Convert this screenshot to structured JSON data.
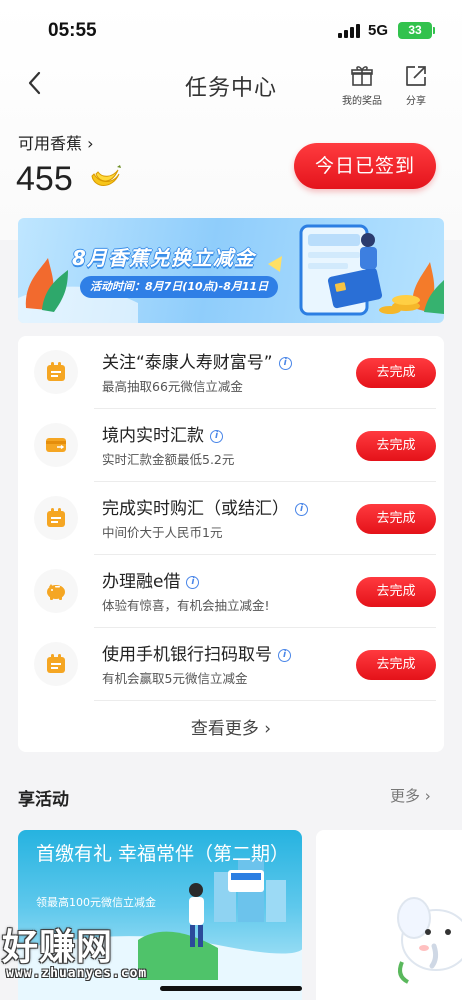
{
  "status_bar": {
    "time": "05:55",
    "network": "5G",
    "battery": "33"
  },
  "nav": {
    "title": "任务中心",
    "actions": [
      {
        "icon": "gift-icon",
        "label": "我的奖品"
      },
      {
        "icon": "share-icon",
        "label": "分享"
      }
    ]
  },
  "points": {
    "label": "可用香蕉 ›",
    "value": "455",
    "icon": "banana-icon"
  },
  "signin_button": "今日已签到",
  "banner": {
    "title": "8月香蕉兑换立减金",
    "time": "活动时间：8月7日(10点)-8月11日"
  },
  "tasks": [
    {
      "title": "关注“泰康人寿财富号”",
      "subtitle": "最高抽取66元微信立减金",
      "button": "去完成",
      "icon": "calendar-icon"
    },
    {
      "title": "境内实时汇款",
      "subtitle": "实时汇款金额最低5.2元",
      "button": "去完成",
      "icon": "card-transfer-icon"
    },
    {
      "title": "完成实时购汇（或结汇）",
      "subtitle": "中间价大于人民币1元",
      "button": "去完成",
      "icon": "calendar-icon"
    },
    {
      "title": "办理融e借",
      "subtitle": "体验有惊喜，有机会抽立减金!",
      "button": "去完成",
      "icon": "piggy-bank-icon"
    },
    {
      "title": "使用手机银行扫码取号",
      "subtitle": "有机会赢取5元微信立减金",
      "button": "去完成",
      "icon": "calendar-icon"
    }
  ],
  "view_more": "查看更多 ›",
  "activities": {
    "title": "享活动",
    "more": "更多 ›",
    "card1": {
      "title": "首缴有礼 幸福常伴（第二期）",
      "subtitle": "领最高100元微信立减金"
    }
  },
  "watermark": {
    "text": "好赚网",
    "url": "www.zhuanyes.com"
  },
  "colors": {
    "accent_red": "#e41219",
    "info_blue": "#4a86e8",
    "icon_orange": "#f5a623"
  }
}
